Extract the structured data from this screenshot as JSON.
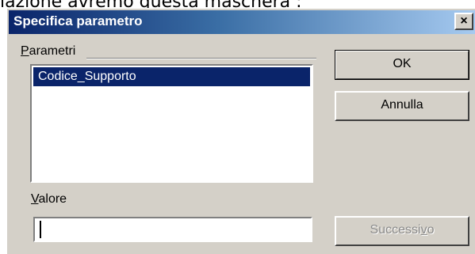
{
  "background_caption": "lazione avremo questa maschera :",
  "dialog": {
    "title": "Specifica parametro",
    "close_label": "×",
    "colors": {
      "face": "#d4d0c8",
      "title_start": "#0a246a",
      "title_end": "#a6caf0",
      "selection": "#0a246a"
    }
  },
  "parameters": {
    "label_first": "P",
    "label_rest": "arametri",
    "items": [
      {
        "label": "Codice_Supporto",
        "selected": true
      }
    ]
  },
  "value": {
    "label_first": "V",
    "label_rest": "alore",
    "current_value": ""
  },
  "buttons": {
    "ok": "OK",
    "cancel": "Annulla",
    "next_before": "Successi",
    "next_underline": "v",
    "next_after": "o",
    "next_enabled": false
  }
}
